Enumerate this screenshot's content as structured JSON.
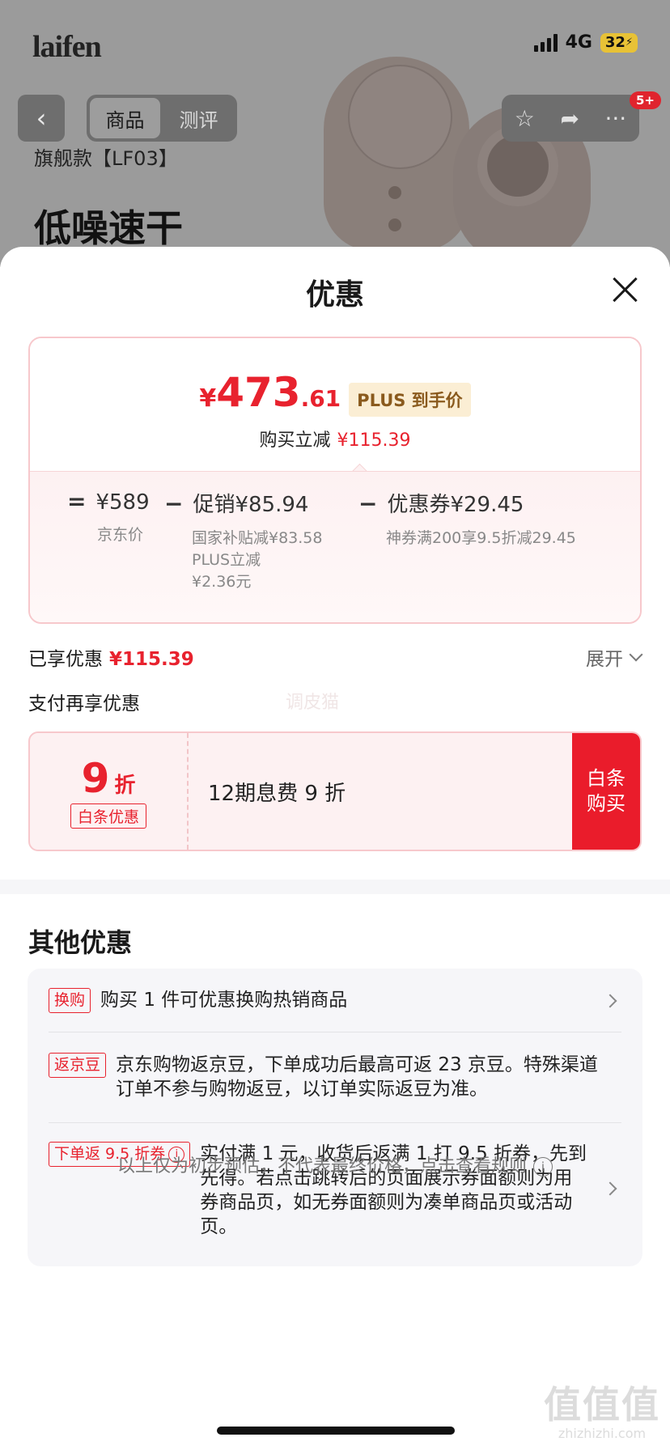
{
  "status_bar": {
    "network": "4G",
    "battery": "32"
  },
  "background_page": {
    "logo": "laifen",
    "tabs": [
      "商品",
      "测评"
    ],
    "active_tab": 0,
    "badge": "5+",
    "sku": "旗舰款【LF03】",
    "slogan": "低噪速干"
  },
  "sheet": {
    "title": "优惠",
    "price_card": {
      "currency": "¥",
      "price_int": "473",
      "price_dec": ".61",
      "plus_tag": "PLUS 到手价",
      "instant_label": "购买立减",
      "instant_amount": "¥115.39",
      "base_op": "=",
      "base_price": "¥589",
      "base_label": "京东价",
      "promo_op": "−",
      "promo": "促销¥85.94",
      "promo_sub1": "国家补贴减¥83.58",
      "promo_sub2": "PLUS立减",
      "promo_sub3": "¥2.36元",
      "coupon_op": "−",
      "coupon": "优惠券¥29.45",
      "coupon_sub": "神券满200享9.5折减29.45"
    },
    "enjoyed_label": "已享优惠",
    "enjoyed_amount": "¥115.39",
    "expand_label": "展开",
    "pay_title": "支付再享优惠",
    "watermark": "调皮猫",
    "baitiao": {
      "discount": "9",
      "unit": "折",
      "tag": "白条优惠",
      "desc": "12期息费 9 折",
      "buy_line1": "白条",
      "buy_line2": "购买"
    },
    "other_title": "其他优惠",
    "offers": [
      {
        "tag": "换购",
        "text": "购买 1 件可优惠换购热销商品"
      },
      {
        "tag": "返京豆",
        "text": "京东购物返京豆，下单成功后最高可返 23 京豆。特殊渠道订单不参与购物返豆，以订单实际返豆为准。"
      },
      {
        "tag": "下单返 9.5 折券",
        "text": "实付满 1 元，收货后返满 1 打 9.5 折券，先到先得。若点击跳转后的页面展示券面额则为用券商品页，如无券面额则为凑单商品页或活动页。"
      }
    ],
    "footnote": "以上仅为初步预估，不代表最终价格，点击查看规则"
  },
  "site_watermark": {
    "big": "值值值",
    "small": "zhizhizhi.com"
  }
}
